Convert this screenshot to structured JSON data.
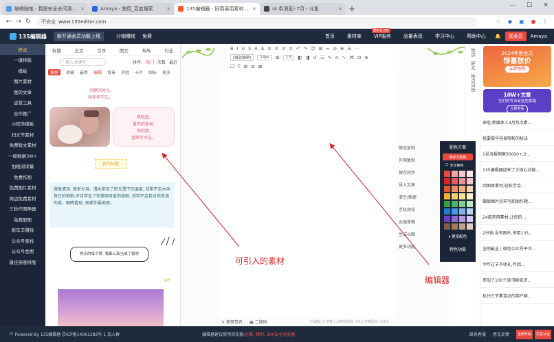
{
  "browser": {
    "tabs": [
      {
        "title": "编辑随笔 · 我愿安全去问滴滴的日记",
        "active": false,
        "color": "#4f9be8"
      },
      {
        "title": "Amaya - 使用_百度搜索",
        "active": false,
        "color": "#2a64d8"
      },
      {
        "title": "135编辑器 - 好用易用素材排版",
        "active": true,
        "color": "#f05b2a"
      },
      {
        "title": "(4 条消息) 7月 - 斗鱼",
        "active": false,
        "color": "#444444"
      }
    ],
    "url_prefix": "不安全",
    "url": "www.135editor.com"
  },
  "header": {
    "logo": "135编辑器",
    "promo_btn": "新开通会员功能上线",
    "link1": "分销赚钱",
    "link2": "免费",
    "nav": [
      {
        "label": "首页"
      },
      {
        "label": "素材库"
      },
      {
        "label": "VIP服务",
        "badge": "限时8.8折"
      },
      {
        "label": "品量表现"
      },
      {
        "label": "学习中心"
      },
      {
        "label": "帮助中心"
      }
    ],
    "user_btn": "送会员",
    "username": "Amaya"
  },
  "sidebar": {
    "items": [
      "样式",
      "一键排版",
      "模板",
      "图片素材",
      "我的文章",
      "运营工具",
      "合作推广",
      "小程序模板",
      "扫文节素材",
      "免费版文素材",
      "一级数据3W+",
      "加粗阅读量",
      "免费作图",
      "免费图片素材",
      "周边免费素材",
      "三秒作图神器",
      "免费配图",
      "新年丰赚钱",
      "公众号查找",
      "公众号会图",
      "最佳随意排版"
    ],
    "active_index": 0
  },
  "materials": {
    "tabs": [
      "标题",
      "正文",
      "引导",
      "图文",
      "布局",
      "行业"
    ],
    "search_placeholder": "输入关键字",
    "sort_label": "排序:",
    "sort_options": [
      "热门",
      "次数",
      "最近"
    ],
    "sub_tabs": [
      "推荐",
      "收藏",
      "最新",
      "编辑",
      "背景",
      "其他",
      "卡片",
      "图标",
      "更多"
    ],
    "top_text": [
      "沉默的时光,",
      "我年年不忘。"
    ],
    "poem": [
      "风吹起,",
      "爱你的发丝,",
      "你的笑,",
      "我终年不忘。"
    ],
    "title_tag": "我的标题",
    "quote": "微微清冽, 原来岁月。清水带走了阳光透下的温度, 却带不走水中自已的倒影;岁月带走了你美丽可爱的容颜, 却带不走我对你真诚的爱。眼睛看现, 很爱你最美丽。",
    "speech": "你点的每个赞, 我都认真当成了喜欢",
    "vip": "VIP"
  },
  "editor": {
    "toolbar_row1": [
      "B",
      "I",
      "U",
      "S",
      "A",
      "A",
      "≡",
      "≡",
      "≡",
      "≡",
      "↶",
      "↷",
      "☺",
      "⊞",
      "∞",
      "⊘",
      "≣",
      "☰",
      "⋯"
    ],
    "toolbar_row2": [
      "[微软雅黑]",
      "14px",
      "⊞",
      "1.5",
      "◧",
      "◨",
      "↺",
      "☷",
      "✎",
      "⊙",
      "∿",
      "⌘",
      "⊡",
      "⊕"
    ],
    "toolbar_row3": [
      "☐",
      "T",
      "⊞",
      "⊟",
      "⊠"
    ],
    "footer_left": "使用签名",
    "footer_mid": "二维码",
    "footer_count": "已编辑: 0 字数 | 计算机保存: 0% | 文章图片: 0/1%"
  },
  "vtools": [
    "微信复制",
    "外网复制",
    "保存同步",
    "导入文章",
    "清空/新建",
    "手机预览",
    "云端草稿",
    "生成长图",
    "更多功能"
  ],
  "color_panel": {
    "title": "配色方案",
    "btn": "保存为配色",
    "opt": "全文换色",
    "swatches": [
      "#e84a3f",
      "#f4a6a6",
      "#f6c7c7",
      "#fbe3e3",
      "#d9242a",
      "#ee5a5a",
      "#f19494",
      "#f7c7c7",
      "#e3562f",
      "#f08f5a",
      "#f4b37f",
      "#f8d7b8",
      "#f0b42b",
      "#f4cf62",
      "#f7e095",
      "#fbf0c8",
      "#2f9e44",
      "#4cb65e",
      "#80cf8b",
      "#b8e6bd",
      "#1f7bd8",
      "#4a98e8",
      "#7fb5f0",
      "#b7d6f7",
      "#6a3fc4",
      "#8d66d6",
      "#b699e6",
      "#d8c8f2",
      "#8a5c3f",
      "#a67c5b",
      "#c4a388",
      "#e0cdbd"
    ],
    "more": "更多配色",
    "fn": "特色功能"
  },
  "rtabs": [
    "热点",
    "好文",
    "热点日历"
  ],
  "right_panel": {
    "promo1": [
      "2024年度会员",
      "惊喜放价",
      "立即抢购"
    ],
    "promo2": [
      "10W+文章",
      "它们的写法有这些套路",
      "立即查看"
    ],
    "articles": [
      "来啦,新媒体人3月热点素...",
      "我要做号容易吸粉的秘诀",
      "1张海报刷屏30000+,2...",
      "135编辑器迎来了大核心功能...",
      "动图原素材,轻松学会...",
      "蝶眼图片怎样写配图作题...",
      "24款常用素材,让你的...",
      "2分钟,没有图片,使用135...",
      "全网最全 | 微信公众号平台...",
      "今年过节不收礼,年回...",
      "参加了100个读书群知识...",
      "杭州三节素连动的用户群..."
    ]
  },
  "annotations": {
    "materials_label": "可引入的素材",
    "editor_label": "编辑器"
  },
  "statusbar": {
    "left": "Powered By 135编辑器 京ICP备14061383号-1 加入群",
    "mid_prefix": "编辑器建议使用浏览器:",
    "mid_browsers": "谷歌, 猎豹, 360安全浏览器",
    "right1": "联系客服",
    "right2": "意见反馈",
    "badge1": "全新升级",
    "badge2": "实名认证"
  },
  "colors": {
    "dark_navy": "#1f2a3c",
    "accent_red": "#e84a3f",
    "annotation": "#d32525"
  }
}
